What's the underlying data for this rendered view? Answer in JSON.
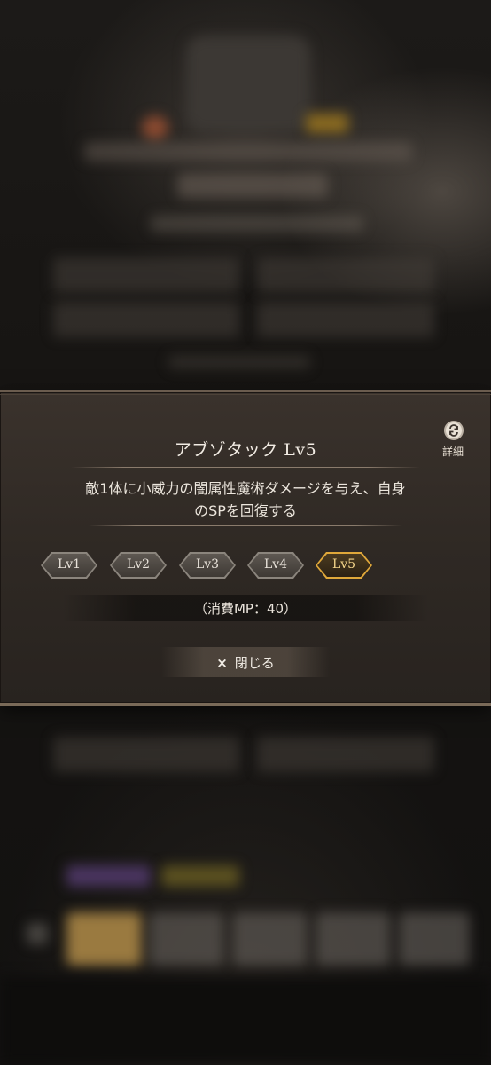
{
  "dialog": {
    "title": "アブゾタック Lv5",
    "detail_label": "詳細",
    "description_line1": "敵1体に小威力の闇属性魔術ダメージを与え、自身",
    "description_line2": "のSPを回復する",
    "levels": [
      "Lv1",
      "Lv2",
      "Lv3",
      "Lv4",
      "Lv5"
    ],
    "selected_level": "Lv5",
    "cost": "（消費MP：40）",
    "close_icon": "×",
    "close_label": "閉じる"
  },
  "colors": {
    "accent_gold": "#e0a83a",
    "panel": "#2f2924",
    "text": "#ece6dd"
  },
  "icons": {
    "detail": "refresh-cycle-icon",
    "close": "close-icon"
  }
}
